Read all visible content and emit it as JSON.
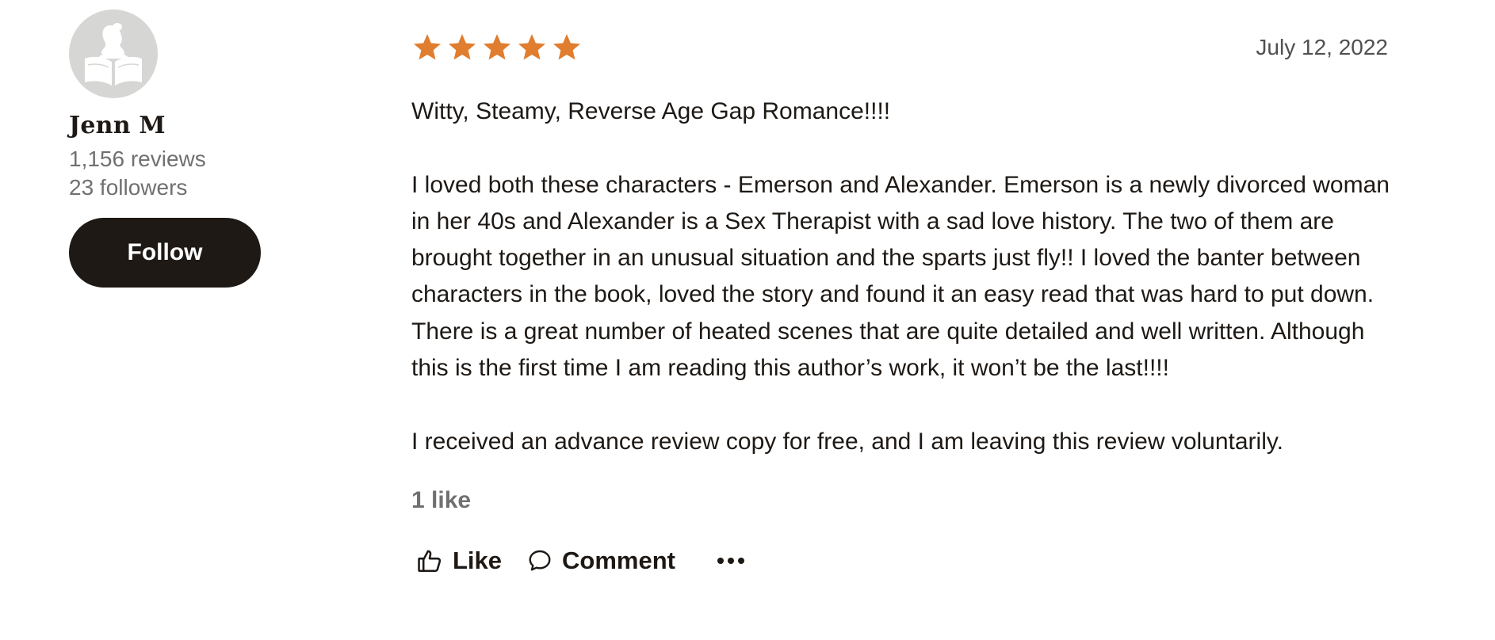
{
  "reviewer": {
    "name": "Jenn M",
    "reviews": "1,156 reviews",
    "followers": "23 followers",
    "follow_label": "Follow",
    "avatar_icon": "reader-silhouette-icon"
  },
  "review": {
    "rating": 5,
    "rating_max": 5,
    "star_color": "#e17d2f",
    "date": "July 12, 2022",
    "paragraphs": [
      "Witty, Steamy, Reverse Age Gap Romance!!!!",
      "I loved both these characters - Emerson and Alexander. Emerson is a newly divorced woman in her 40s and Alexander is a Sex Therapist with a sad love history. The two of them are brought together in an unusual situation and the sparts just fly!! I loved the banter between characters in the book, loved the story and found it an easy read that was hard to put down. There is a great number of heated scenes that are quite detailed and well written. Although this is the first time I am reading this author’s work, it won’t be the last!!!!",
      "I received an advance review copy for free, and I am leaving this review voluntarily."
    ],
    "likes_count": "1 like"
  },
  "actions": {
    "like_label": "Like",
    "comment_label": "Comment",
    "like_icon": "thumbs-up-icon",
    "comment_icon": "speech-bubble-icon",
    "more_icon": "more-dots-icon"
  },
  "colors": {
    "primary_text": "#1e1915",
    "secondary_text": "#707070",
    "button_bg": "#1e1915",
    "avatar_bg": "#d6d6d4"
  }
}
